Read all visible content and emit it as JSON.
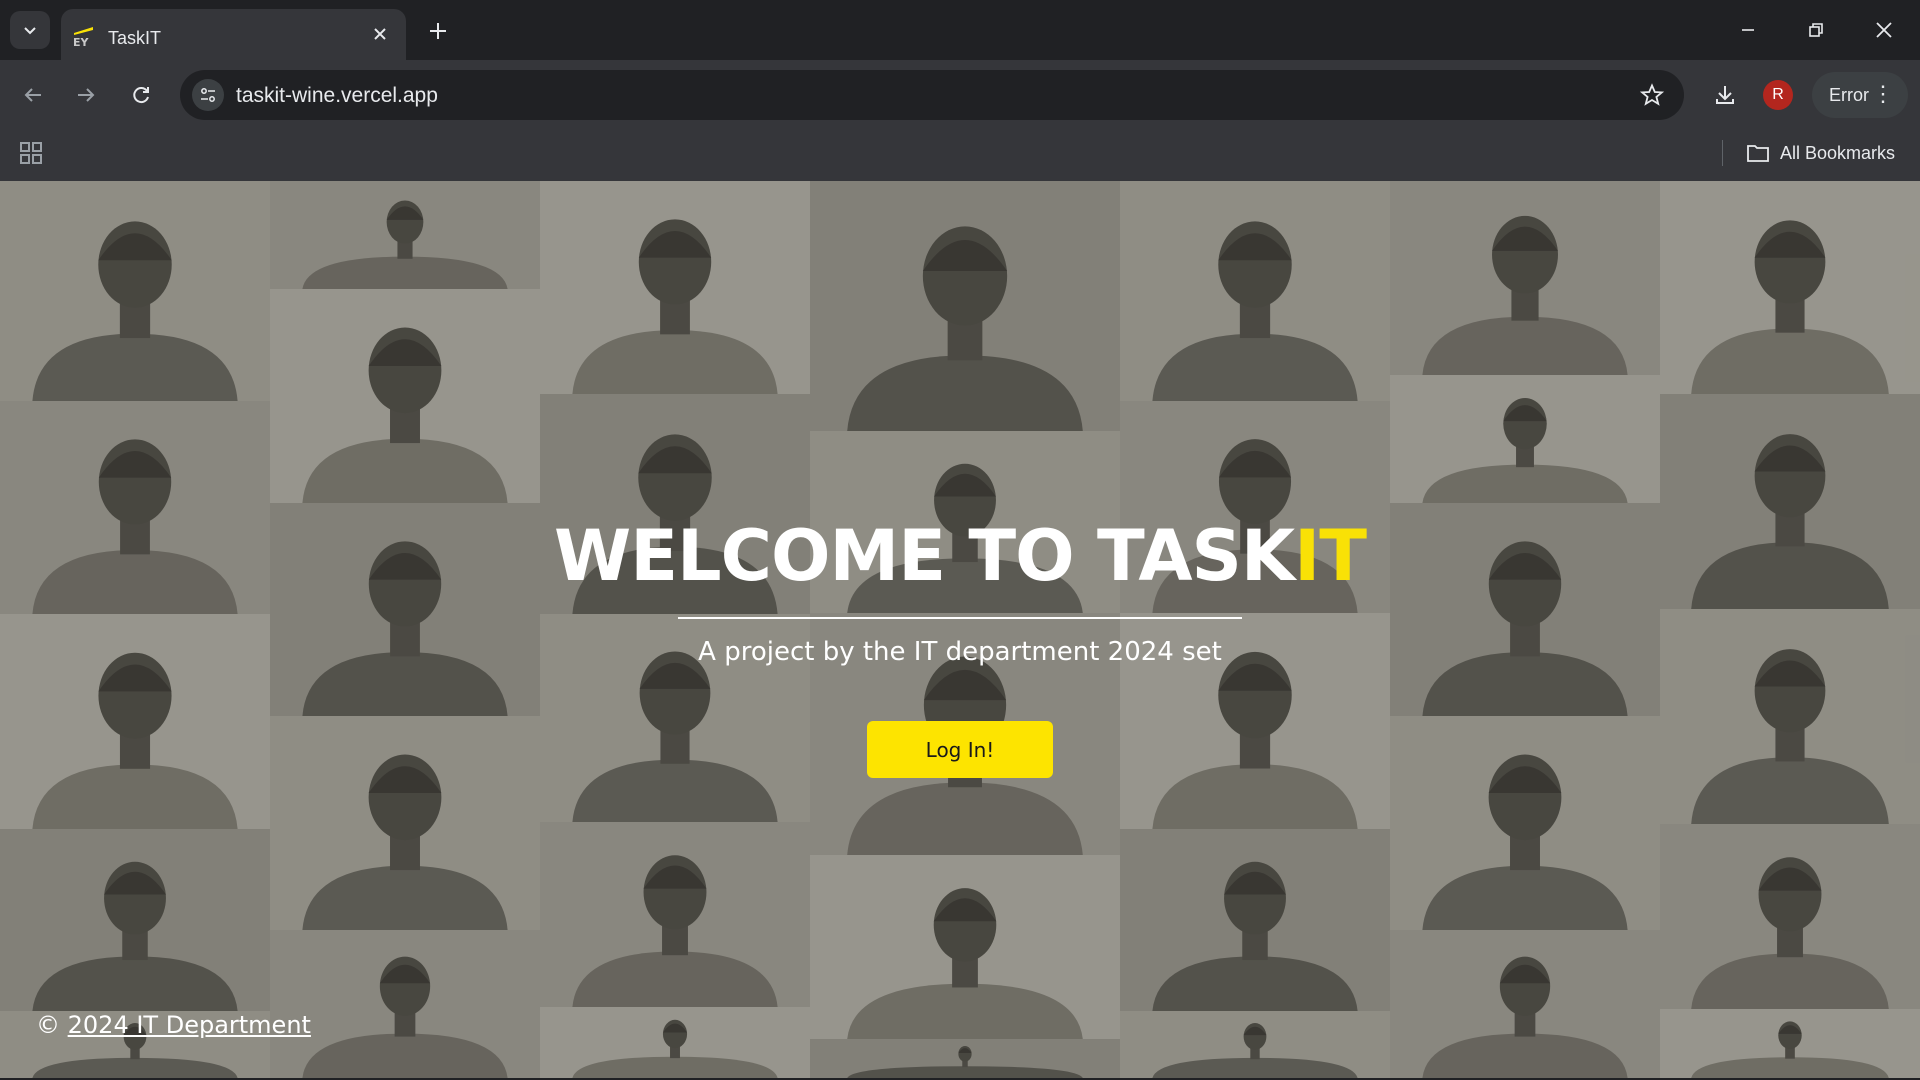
{
  "browser": {
    "tab_title": "TaskIT",
    "url": "taskit-wine.vercel.app",
    "profile_initial": "R",
    "error_label": "Error",
    "all_bookmarks": "All Bookmarks",
    "colors": {
      "frame": "#202124",
      "toolbar": "#35363a",
      "profile": "#b3261e"
    }
  },
  "hero": {
    "title_main": "WELCOME TO TASK",
    "title_accent": "IT",
    "subtitle": "A project by the IT department 2024 set",
    "login_label": "Log In!",
    "colors": {
      "accent": "#f9e106",
      "button": "#fde400"
    }
  },
  "footer": {
    "copyright_symbol": "©",
    "link_text": "2024 IT Department"
  },
  "background": {
    "description_tiles": 36,
    "tone": [
      "#b3b1aa",
      "#a9a7a0",
      "#c1bfb8",
      "#9d9b94"
    ]
  }
}
